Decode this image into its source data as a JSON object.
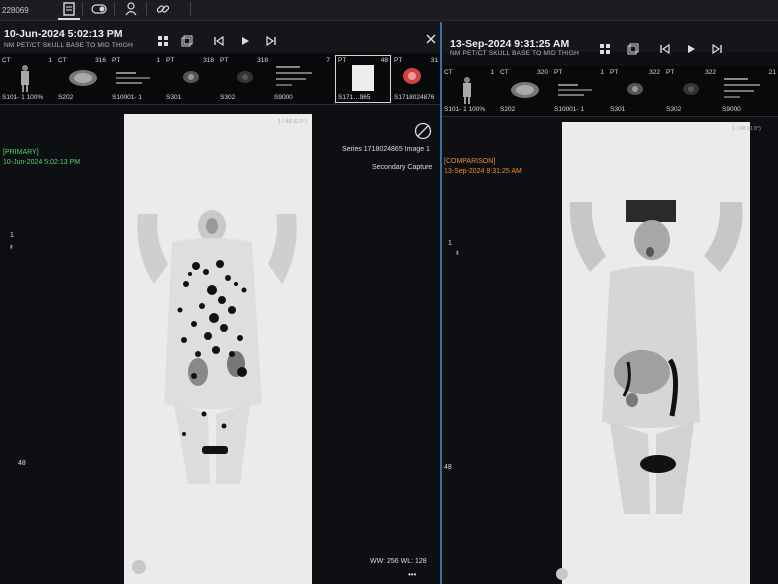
{
  "topbar": {
    "patient_id": "228069",
    "icons": [
      "document-icon",
      "toggle-icon",
      "person-icon",
      "link-icon"
    ]
  },
  "left_viewer": {
    "date": "10-Jun-2024 5:02:13 PM",
    "study": "NM PET/CT SKULL BASE TO MID THIGH",
    "thumbnails": [
      {
        "modality": "CT",
        "count": "1",
        "series": "S101- 1 100%"
      },
      {
        "modality": "CT",
        "count": "316",
        "series": "S202"
      },
      {
        "modality": "PT",
        "count": "1",
        "series": "S10001- 1"
      },
      {
        "modality": "PT",
        "count": "318",
        "series": "S301"
      },
      {
        "modality": "PT",
        "count": "318",
        "series": "S302"
      },
      {
        "modality": "",
        "count": "7",
        "series": "S9000"
      },
      {
        "modality": "PT",
        "count": "48",
        "series": "S171…965"
      },
      {
        "modality": "PT",
        "count": "31",
        "series": "S1718024876"
      }
    ],
    "tag": "[PRIMARY]",
    "tag_date": "10-Jun-2024 5:02:13 PM",
    "series_info": "Series 1718024865 Image 1",
    "capture": "Secondary Capture",
    "slice_index": "1 / 48 (0.0°)",
    "scale_top": "1",
    "scale_bottom": "48",
    "window_level": "WW: 256 WL: 128",
    "more": "•••"
  },
  "right_viewer": {
    "date": "13-Sep-2024 9:31:25 AM",
    "study": "NM PET/CT SKULL BASE TO MID THIGH",
    "thumbnails": [
      {
        "modality": "CT",
        "count": "1",
        "series": "S101- 1 100%"
      },
      {
        "modality": "CT",
        "count": "320",
        "series": "S202"
      },
      {
        "modality": "PT",
        "count": "1",
        "series": "S10001- 1"
      },
      {
        "modality": "PT",
        "count": "322",
        "series": "S301"
      },
      {
        "modality": "PT",
        "count": "322",
        "series": "S302"
      },
      {
        "modality": "",
        "count": "21",
        "series": "S9000"
      }
    ],
    "tag": "[COMPARISON]",
    "tag_date": "13-Sep-2024 9:31:25 AM",
    "slice_index": "1 / 48 (0.0°)",
    "scale_top": "1",
    "scale_bottom": "48"
  },
  "colors": {
    "primary": "#57d36f",
    "comparison": "#f08a35",
    "accent": "#3a6fa8"
  }
}
